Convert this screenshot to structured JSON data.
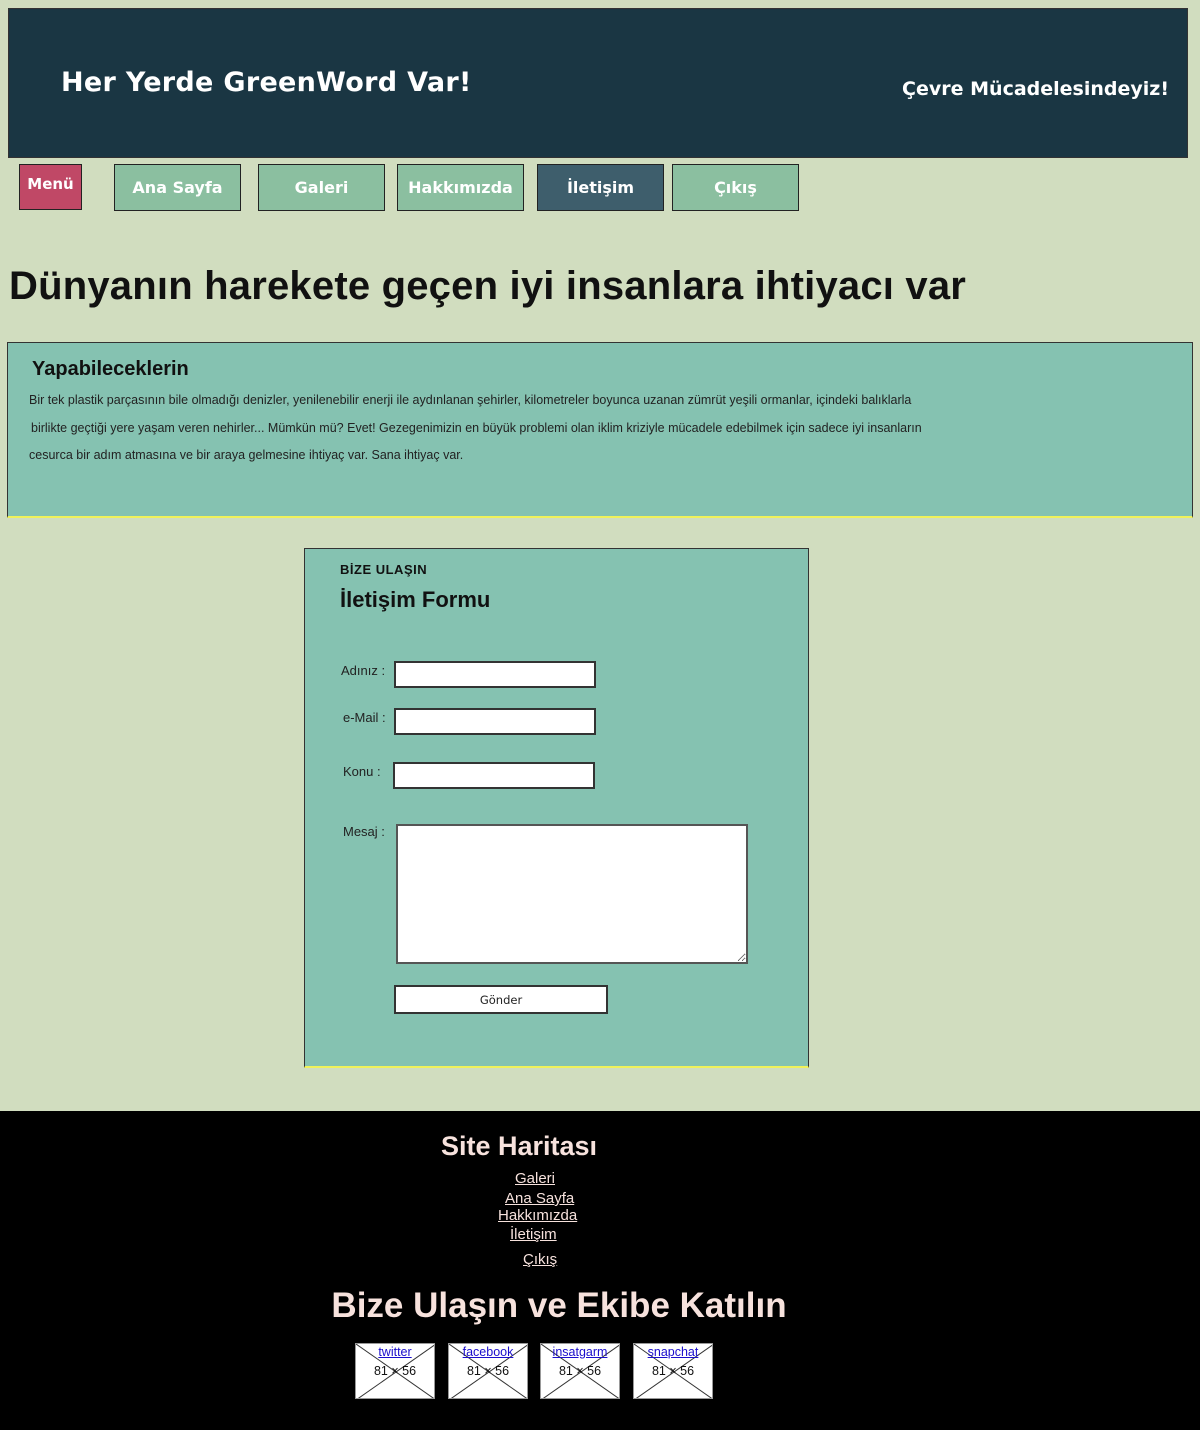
{
  "header": {
    "brand": "Her Yerde GreenWord Var!",
    "slogan": "Çevre Mücadelesindeyiz!"
  },
  "nav": {
    "menu_label": "Menü",
    "items": [
      {
        "label": "Ana Sayfa",
        "active": false
      },
      {
        "label": "Galeri",
        "active": false
      },
      {
        "label": "Hakkımızda",
        "active": false
      },
      {
        "label": "İletişim",
        "active": true
      },
      {
        "label": "Çıkış",
        "active": false
      }
    ]
  },
  "hero": {
    "title": "Dünyanın harekete geçen iyi insanlara ihtiyacı var"
  },
  "info": {
    "heading": "Yapabileceklerin",
    "lines": [
      "Bir tek plastik parçasının bile olmadığı denizler, yenilenebilir enerji ile aydınlanan     şehirler, kilometreler boyunca uzanan zümrüt yeşili ormanlar, içindeki balıklarla",
      "birlikte geçtiği yere yaşam veren nehirler... Mümkün mü? Evet! Gezegenimizin en büyük problemi olan iklim kriziyle mücadele edebilmek için sadece iyi insanların",
      "cesurca bir adım atmasına ve bir araya gelmesine ihtiyaç var. Sana ihtiyaç var."
    ]
  },
  "form": {
    "kicker": "BİZE ULAŞIN",
    "title": "İletişim Formu",
    "name_label": "Adınız :",
    "name_value": "",
    "email_label": "e-Mail :",
    "email_value": "",
    "subject_label": "Konu :",
    "subject_value": "",
    "message_label": "Mesaj :",
    "message_value": "",
    "submit_label": "Gönder"
  },
  "footer": {
    "sitemap_title": "Site Haritası",
    "sitemap_links": [
      "Galeri",
      "Ana Sayfa",
      "Hakkımızda",
      "İletişim",
      "Çıkış"
    ],
    "join_title": "Bize Ulaşın ve Ekibe Katılın",
    "social": [
      {
        "label": "twitter",
        "size": "81 × 56"
      },
      {
        "label": "facebook",
        "size": "81 × 56"
      },
      {
        "label": "insatgarm",
        "size": "81 × 56"
      },
      {
        "label": "snapchat",
        "size": "81 × 56"
      }
    ]
  },
  "colors": {
    "page_bg": "#d1ddbf",
    "header_bg": "#1a3643",
    "menu_button": "#c04866",
    "nav_button": "#8bbfa0",
    "nav_active": "#3e5e6c",
    "panel_bg": "#85c2b1",
    "panel_underline": "#f0f25a",
    "footer_bg": "#000000",
    "footer_text": "#f7e2dd"
  }
}
